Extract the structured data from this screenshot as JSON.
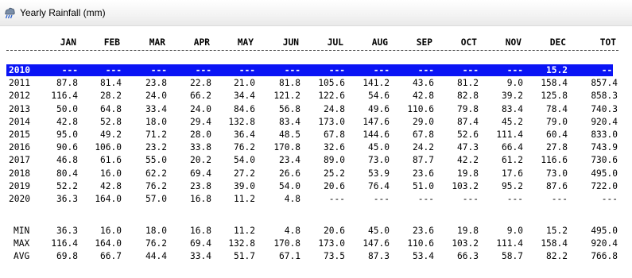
{
  "window": {
    "title": "Yearly Rainfall (mm)",
    "icon": "rain-cloud-icon"
  },
  "columns": [
    "JAN",
    "FEB",
    "MAR",
    "APR",
    "MAY",
    "JUN",
    "JUL",
    "AUG",
    "SEP",
    "OCT",
    "NOV",
    "DEC",
    "TOT"
  ],
  "separator": "----------------------------------------------------------------------------------------------------------",
  "years": [
    {
      "year": "2010",
      "values": [
        "---",
        "---",
        "---",
        "---",
        "---",
        "---",
        "---",
        "---",
        "---",
        "---",
        "---",
        "15.2",
        "---"
      ],
      "selected": true
    },
    {
      "year": "2011",
      "values": [
        "87.8",
        "81.4",
        "23.8",
        "22.8",
        "21.0",
        "81.8",
        "105.6",
        "141.2",
        "43.6",
        "81.2",
        "9.0",
        "158.4",
        "857.4"
      ]
    },
    {
      "year": "2012",
      "values": [
        "116.4",
        "28.2",
        "24.0",
        "66.2",
        "34.4",
        "121.2",
        "122.6",
        "54.6",
        "42.8",
        "82.8",
        "39.2",
        "125.8",
        "858.3"
      ]
    },
    {
      "year": "2013",
      "values": [
        "50.0",
        "64.8",
        "33.4",
        "24.0",
        "84.6",
        "56.8",
        "24.8",
        "49.6",
        "110.6",
        "79.8",
        "83.4",
        "78.4",
        "740.3"
      ]
    },
    {
      "year": "2014",
      "values": [
        "42.8",
        "52.8",
        "18.0",
        "29.4",
        "132.8",
        "83.4",
        "173.0",
        "147.6",
        "29.0",
        "87.4",
        "45.2",
        "79.0",
        "920.4"
      ]
    },
    {
      "year": "2015",
      "values": [
        "95.0",
        "49.2",
        "71.2",
        "28.0",
        "36.4",
        "48.5",
        "67.8",
        "144.6",
        "67.8",
        "52.6",
        "111.4",
        "60.4",
        "833.0"
      ]
    },
    {
      "year": "2016",
      "values": [
        "90.6",
        "106.0",
        "23.2",
        "33.8",
        "76.2",
        "170.8",
        "32.6",
        "45.0",
        "24.2",
        "47.3",
        "66.4",
        "27.8",
        "743.9"
      ]
    },
    {
      "year": "2017",
      "values": [
        "46.8",
        "61.6",
        "55.0",
        "20.2",
        "54.0",
        "23.4",
        "89.0",
        "73.0",
        "87.7",
        "42.2",
        "61.2",
        "116.6",
        "730.6"
      ]
    },
    {
      "year": "2018",
      "values": [
        "80.4",
        "16.0",
        "62.2",
        "69.4",
        "27.2",
        "26.6",
        "25.2",
        "53.9",
        "23.6",
        "19.8",
        "17.6",
        "73.0",
        "495.0"
      ]
    },
    {
      "year": "2019",
      "values": [
        "52.2",
        "42.8",
        "76.2",
        "23.8",
        "39.0",
        "54.0",
        "20.6",
        "76.4",
        "51.0",
        "103.2",
        "95.2",
        "87.6",
        "722.0"
      ]
    },
    {
      "year": "2020",
      "values": [
        "36.3",
        "164.0",
        "57.0",
        "16.8",
        "11.2",
        "4.8",
        "---",
        "---",
        "---",
        "---",
        "---",
        "---",
        "---"
      ]
    }
  ],
  "summary": [
    {
      "label": "MIN",
      "values": [
        "36.3",
        "16.0",
        "18.0",
        "16.8",
        "11.2",
        "4.8",
        "20.6",
        "45.0",
        "23.6",
        "19.8",
        "9.0",
        "15.2",
        "495.0"
      ]
    },
    {
      "label": "MAX",
      "values": [
        "116.4",
        "164.0",
        "76.2",
        "69.4",
        "132.8",
        "170.8",
        "173.0",
        "147.6",
        "110.6",
        "103.2",
        "111.4",
        "158.4",
        "920.4"
      ]
    },
    {
      "label": "AVG",
      "values": [
        "69.8",
        "66.7",
        "44.4",
        "33.4",
        "51.7",
        "67.1",
        "73.5",
        "87.3",
        "53.4",
        "66.3",
        "58.7",
        "82.2",
        "766.8"
      ]
    }
  ]
}
